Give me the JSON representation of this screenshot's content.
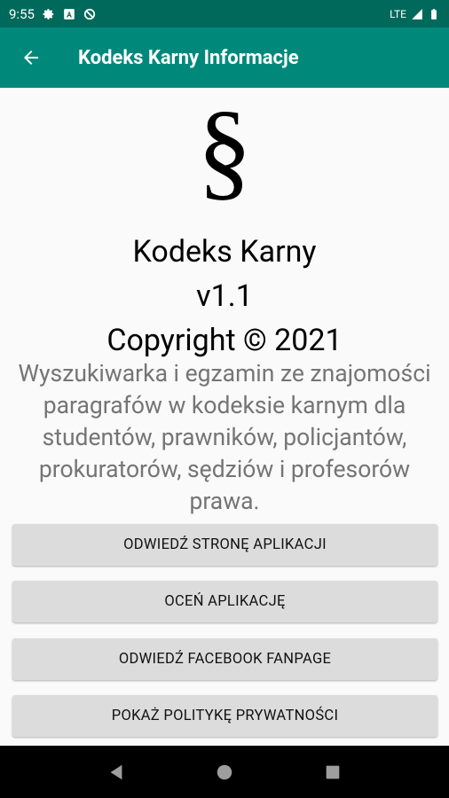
{
  "status_bar": {
    "time": "9:55",
    "network": "LTE",
    "left_icons": [
      "settings-icon",
      "notification-a-icon",
      "blocked-icon"
    ],
    "right_icons": [
      "signal-icon",
      "battery-icon"
    ]
  },
  "app_bar": {
    "title": "Kodeks Karny Informacje",
    "back_icon": "arrow-back-icon"
  },
  "logo": {
    "symbol": "§"
  },
  "app_info": {
    "name": "Kodeks Karny",
    "version": "v1.1",
    "copyright": "Copyright © 2021"
  },
  "description": "Wyszukiwarka i egzamin ze znajomości paragrafów w kodeksie karnym dla studentów, prawników, policjantów, prokuratorów, sędziów i profesorów prawa.",
  "buttons": {
    "visit_site": "ODWIEDŹ STRONĘ APLIKACJI",
    "rate_app": "OCEŃ APLIKACJĘ",
    "facebook": "ODWIEDŹ FACEBOOK FANPAGE",
    "privacy": "POKAŻ POLITYKĘ PRYWATNOŚCI"
  },
  "nav_bar": {
    "icons": [
      "back-triangle-icon",
      "home-circle-icon",
      "recents-square-icon"
    ]
  },
  "colors": {
    "status_bar": "#00695c",
    "app_bar": "#00897b",
    "button_bg": "#dcdcdc",
    "description_text": "#757575"
  }
}
